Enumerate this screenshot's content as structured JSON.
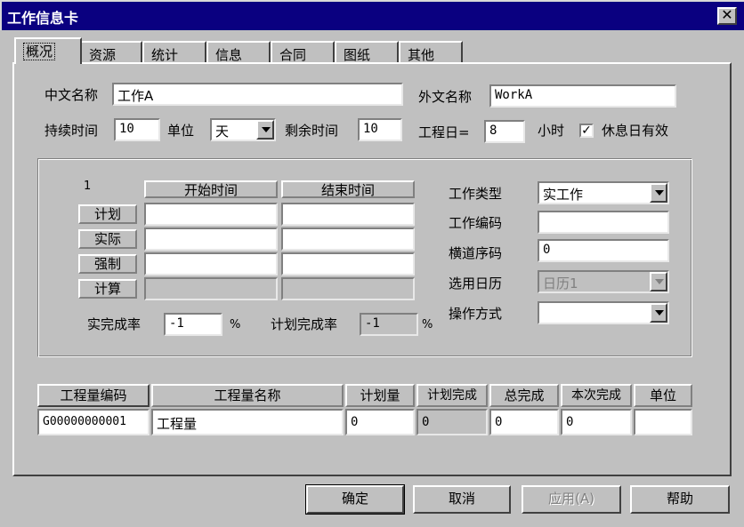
{
  "window": {
    "title": "工作信息卡",
    "close_glyph": "✕"
  },
  "tabs": [
    {
      "label": "概况",
      "active": true
    },
    {
      "label": "资源"
    },
    {
      "label": "统计"
    },
    {
      "label": "信息"
    },
    {
      "label": "合同"
    },
    {
      "label": "图纸"
    },
    {
      "label": "其他"
    }
  ],
  "general": {
    "cn_name_label": "中文名称",
    "cn_name_value": "工作A",
    "en_name_label": "外文名称",
    "en_name_value": "WorkA",
    "duration_label": "持续时间",
    "duration_value": "10",
    "unit_label": "单位",
    "unit_value": "天",
    "remaining_label": "剩余时间",
    "remaining_value": "10",
    "workday_label": "工程日=",
    "workday_value": "8",
    "hours_label": "小时",
    "rest_day_label": "休息日有效",
    "rest_day_checked": "✓"
  },
  "schedule": {
    "corner": "1",
    "col_start": "开始时间",
    "col_end": "结束时间",
    "rows": [
      {
        "label": "计划",
        "start": "",
        "end": "",
        "disabled": false
      },
      {
        "label": "实际",
        "start": "",
        "end": "",
        "disabled": false
      },
      {
        "label": "强制",
        "start": "",
        "end": "",
        "disabled": false
      },
      {
        "label": "计算",
        "start": "",
        "end": "",
        "disabled": true
      }
    ],
    "actual_rate_label": "实完成率",
    "actual_rate_value": "-1",
    "actual_rate_unit": "%",
    "plan_rate_label": "计划完成率",
    "plan_rate_value": "-1",
    "plan_rate_unit": "%"
  },
  "attributes": {
    "type_label": "工作类型",
    "type_value": "实工作",
    "code_label": "工作编码",
    "code_value": "",
    "lane_label": "横道序码",
    "lane_value": "0",
    "calendar_label": "选用日历",
    "calendar_value": "日历1",
    "op_label": "操作方式",
    "op_value": ""
  },
  "quantity": {
    "headers": [
      "工程量编码",
      "工程量名称",
      "计划量",
      "计划完成",
      "总完成",
      "本次完成",
      "单位"
    ],
    "row": [
      "G00000000001",
      "工程量",
      "0",
      "0",
      "0",
      "0",
      ""
    ]
  },
  "buttons": {
    "ok": "确定",
    "cancel": "取消",
    "apply": "应用(A)",
    "help": "帮助"
  }
}
